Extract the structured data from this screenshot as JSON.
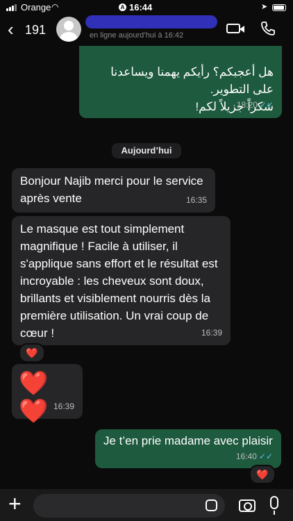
{
  "status_bar": {
    "carrier": "Orange",
    "time": "16:44"
  },
  "header": {
    "back_count": "191",
    "presence": "en ligne aujourd’hui à 16:42"
  },
  "messages": [
    {
      "text": "هل أعجبكم؟ رأيكم يهمنا ويساعدنا على التطوير.\nشكراً جزيلاً لكم!",
      "time": "18:20",
      "direction": "out"
    },
    {
      "text": "Bonjour Najib merci pour le service après vente",
      "time": "16:35",
      "direction": "in"
    },
    {
      "text": "Le masque est tout simplement magnifique ! Facile à utiliser, il s'applique sans effort et le résultat est incroyable : les cheveux sont doux, brillants et visiblement nourris dès la première utilisation. Un vrai coup de cœur !",
      "time": "16:39",
      "direction": "in"
    },
    {
      "text": "❤️ ❤️",
      "time": "16:39",
      "direction": "in"
    },
    {
      "text": "Je t’en prie madame avec plaisir",
      "time": "16:40",
      "direction": "out"
    }
  ],
  "date_separator": "Aujourd’hui",
  "reactions": {
    "msg3": "❤️",
    "msg5": "❤️"
  },
  "colors": {
    "incoming": "#262628",
    "outgoing": "#1e5a3e",
    "read_ticks": "#53bdeb",
    "background": "#0b0b0b"
  },
  "icons": [
    "chevron-left-icon",
    "avatar",
    "video-call-icon",
    "phone-icon",
    "plus-icon",
    "sticker-icon",
    "camera-icon",
    "microphone-icon"
  ]
}
